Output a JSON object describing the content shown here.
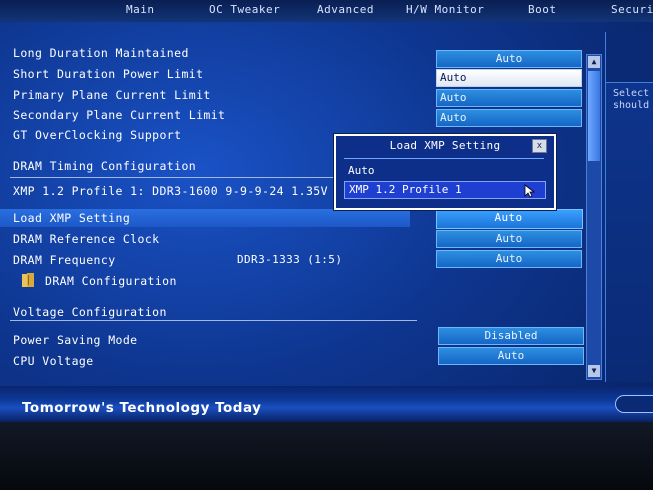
{
  "tabs": [
    {
      "label": "Main"
    },
    {
      "label": "OC Tweaker"
    },
    {
      "label": "Advanced"
    },
    {
      "label": "H/W Monitor"
    },
    {
      "label": "Boot"
    },
    {
      "label": "Securit"
    }
  ],
  "settings": {
    "long_duration": {
      "label": "Long Duration Maintained",
      "value": "Auto"
    },
    "short_duration": {
      "label": "Short Duration Power Limit",
      "value": "Auto"
    },
    "primary_plane": {
      "label": "Primary Plane Current Limit",
      "value": "Auto"
    },
    "secondary_plane": {
      "label": "Secondary Plane Current Limit",
      "value": "Auto"
    },
    "gt_overclocking": {
      "label": "GT OverClocking Support"
    },
    "dram_timing_section": "DRAM Timing Configuration",
    "xmp_profile_info": "XMP 1.2 Profile 1: DDR3-1600 9-9-9-24 1.35V",
    "load_xmp": {
      "label": "Load XMP Setting",
      "value": "Auto"
    },
    "dram_ref_clock": {
      "label": "DRAM Reference Clock",
      "value": "Auto"
    },
    "dram_frequency": {
      "label": "DRAM Frequency",
      "info": "DDR3-1333 (1:5)",
      "value": "Auto"
    },
    "dram_configuration": {
      "label": "DRAM Configuration"
    },
    "voltage_section": "Voltage Configuration",
    "power_saving": {
      "label": "Power Saving Mode",
      "value": "Disabled"
    },
    "cpu_voltage": {
      "label": "CPU Voltage",
      "value": "Auto"
    }
  },
  "help": {
    "line1": "Select",
    "line2": "should"
  },
  "popup": {
    "title": "Load XMP Setting",
    "close": "x",
    "options": [
      {
        "label": "Auto"
      },
      {
        "label": "XMP 1.2 Profile 1"
      }
    ]
  },
  "footer": {
    "tagline": "Tomorrow's Technology Today"
  },
  "colors": {
    "background": "#0e3690",
    "highlight": "#2a6fe0",
    "value_box": "#1566c6"
  }
}
